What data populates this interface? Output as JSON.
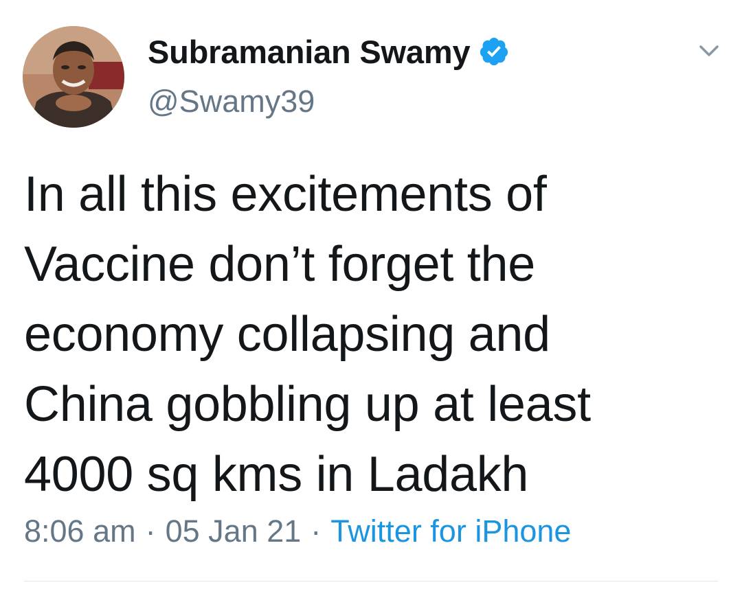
{
  "tweet": {
    "author": {
      "display_name": "Subramanian Swamy",
      "handle": "@Swamy39",
      "verified": true
    },
    "text": "In all this excitements of\nVaccine don’t forget the\neconomy collapsing and\nChina gobbling up at least\n4000 sq kms in Ladakh",
    "time": "8:06 am",
    "separator": "·",
    "date": "05 Jan 21",
    "source": "Twitter for iPhone"
  },
  "icons": {
    "verified": "verified-badge-icon",
    "menu": "chevron-down-icon"
  },
  "colors": {
    "text": "#14171a",
    "secondary": "#657786",
    "link": "#1b95e0",
    "verified": "#1da1f2",
    "divider": "#e1e8ed"
  }
}
